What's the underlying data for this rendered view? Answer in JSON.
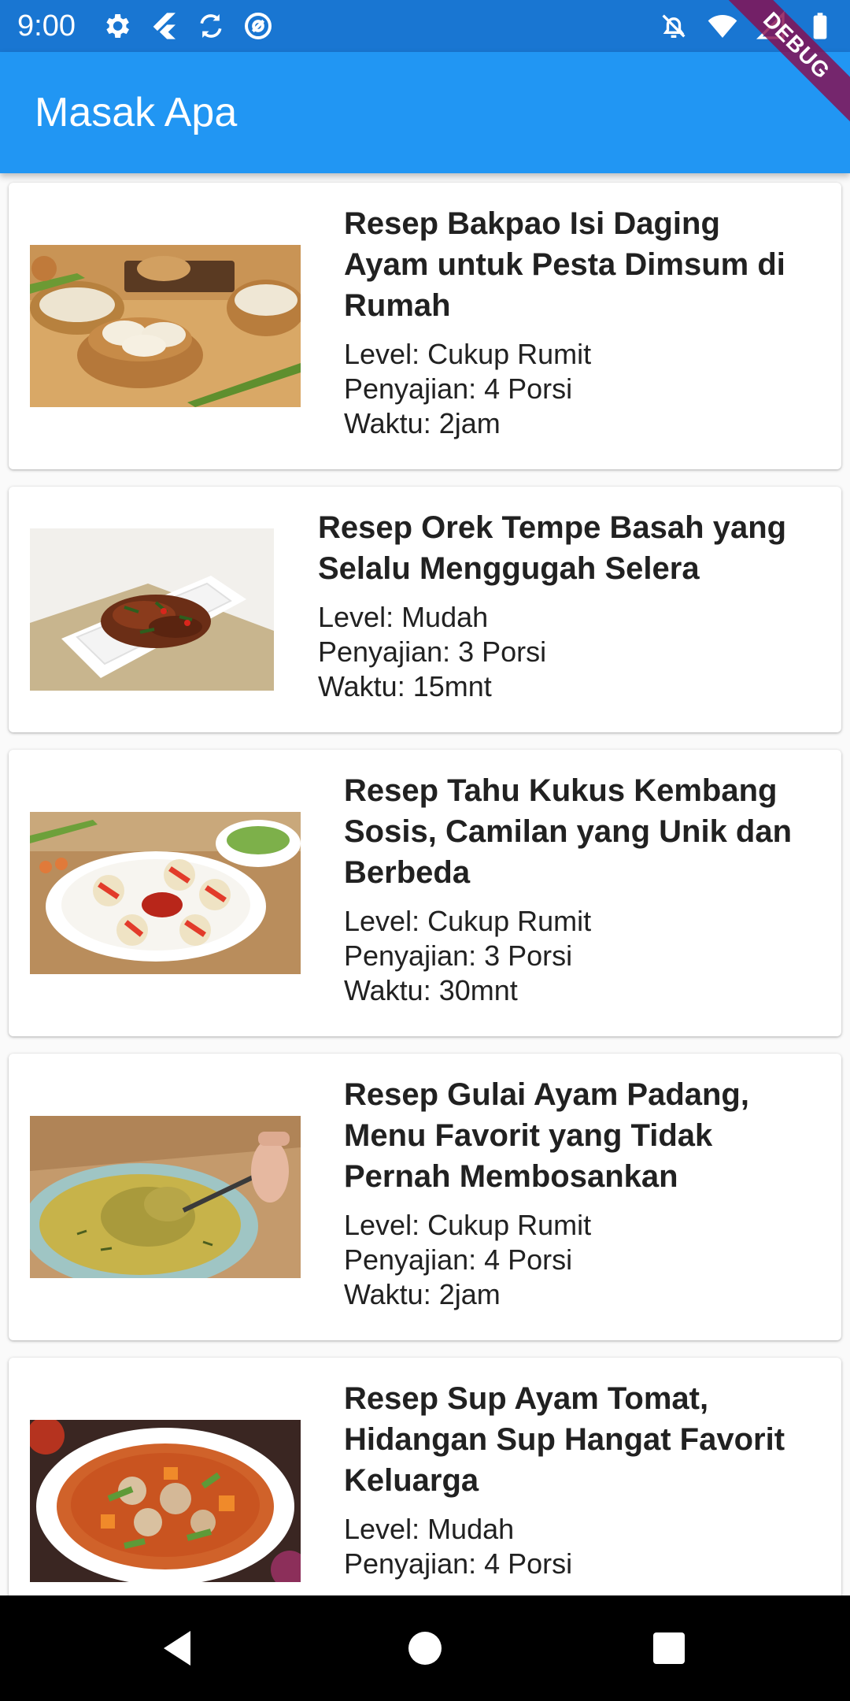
{
  "status_bar": {
    "time": "9:00"
  },
  "app_bar": {
    "title": "Masak Apa"
  },
  "debug_banner": {
    "label": "DEBUG",
    "color": "#880E4F"
  },
  "colors": {
    "status_bar": "#1976D2",
    "app_bar": "#2196F3",
    "nav_bar": "#000000"
  },
  "recipes": [
    {
      "title": "Resep Bakpao Isi Daging Ayam untuk Pesta Dimsum di Rumah",
      "level": "Level: Cukup Rumit",
      "serving": "Penyajian: 4 Porsi",
      "time": "Waktu: 2jam"
    },
    {
      "title": "Resep Orek Tempe Basah yang Selalu Menggugah Selera",
      "level": "Level: Mudah",
      "serving": "Penyajian: 3 Porsi",
      "time": "Waktu: 15mnt"
    },
    {
      "title": "Resep Tahu Kukus Kembang Sosis, Camilan yang Unik dan Berbeda",
      "level": "Level: Cukup Rumit",
      "serving": "Penyajian: 3 Porsi",
      "time": "Waktu: 30mnt"
    },
    {
      "title": "Resep Gulai Ayam Padang, Menu Favorit yang Tidak Pernah Membosankan",
      "level": "Level: Cukup Rumit",
      "serving": "Penyajian: 4 Porsi",
      "time": "Waktu: 2jam"
    },
    {
      "title": "Resep Sup Ayam Tomat, Hidangan Sup Hangat Favorit Keluarga",
      "level": "Level: Mudah",
      "serving": "Penyajian: 4 Porsi",
      "time": ""
    }
  ],
  "icons": {
    "status_left": [
      "gear-icon",
      "flutter-icon",
      "sync-icon",
      "at-sign-icon"
    ],
    "status_right": [
      "notifications-off-icon",
      "wifi-icon",
      "signal-icon",
      "battery-icon"
    ],
    "nav": [
      "back-triangle-icon",
      "home-circle-icon",
      "recents-square-icon"
    ]
  }
}
